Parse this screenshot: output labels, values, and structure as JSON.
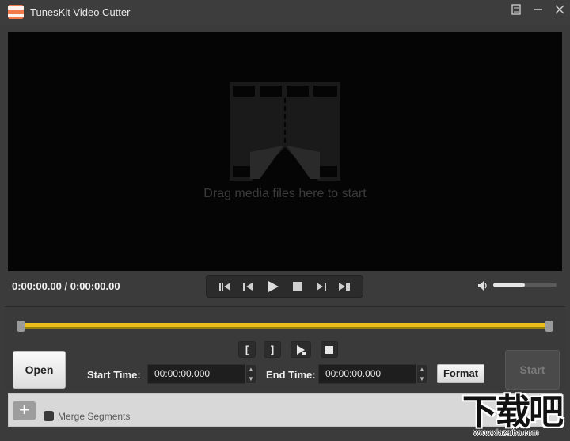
{
  "window": {
    "title": "TunesKit Video Cutter",
    "menu_icon": "menu-list-icon",
    "minimize_icon": "minimize-icon",
    "close_icon": "close-icon"
  },
  "player": {
    "drop_hint": "Drag media files here to start",
    "timecode": "0:00:00.00 / 0:00:00.00",
    "volume_level": 0.5,
    "controls": [
      "skip-to-start-icon",
      "step-back-icon",
      "play-icon",
      "stop-icon",
      "step-forward-icon",
      "skip-to-end-icon"
    ]
  },
  "editor": {
    "timeline_color": "#e8c21a",
    "mark_start_label": "[",
    "mark_end_label": "]",
    "open_label": "Open",
    "start_time_label": "Start Time:",
    "start_time_value": "00:00:00.000",
    "end_time_label": "End Time:",
    "end_time_value": "00:00:00.000",
    "format_label": "Format",
    "start_label": "Start"
  },
  "segments": {
    "add_label": "+",
    "merge_label": "Merge Segments"
  },
  "watermark": {
    "text": "下载吧",
    "url": "www.xiazaiba.com"
  }
}
